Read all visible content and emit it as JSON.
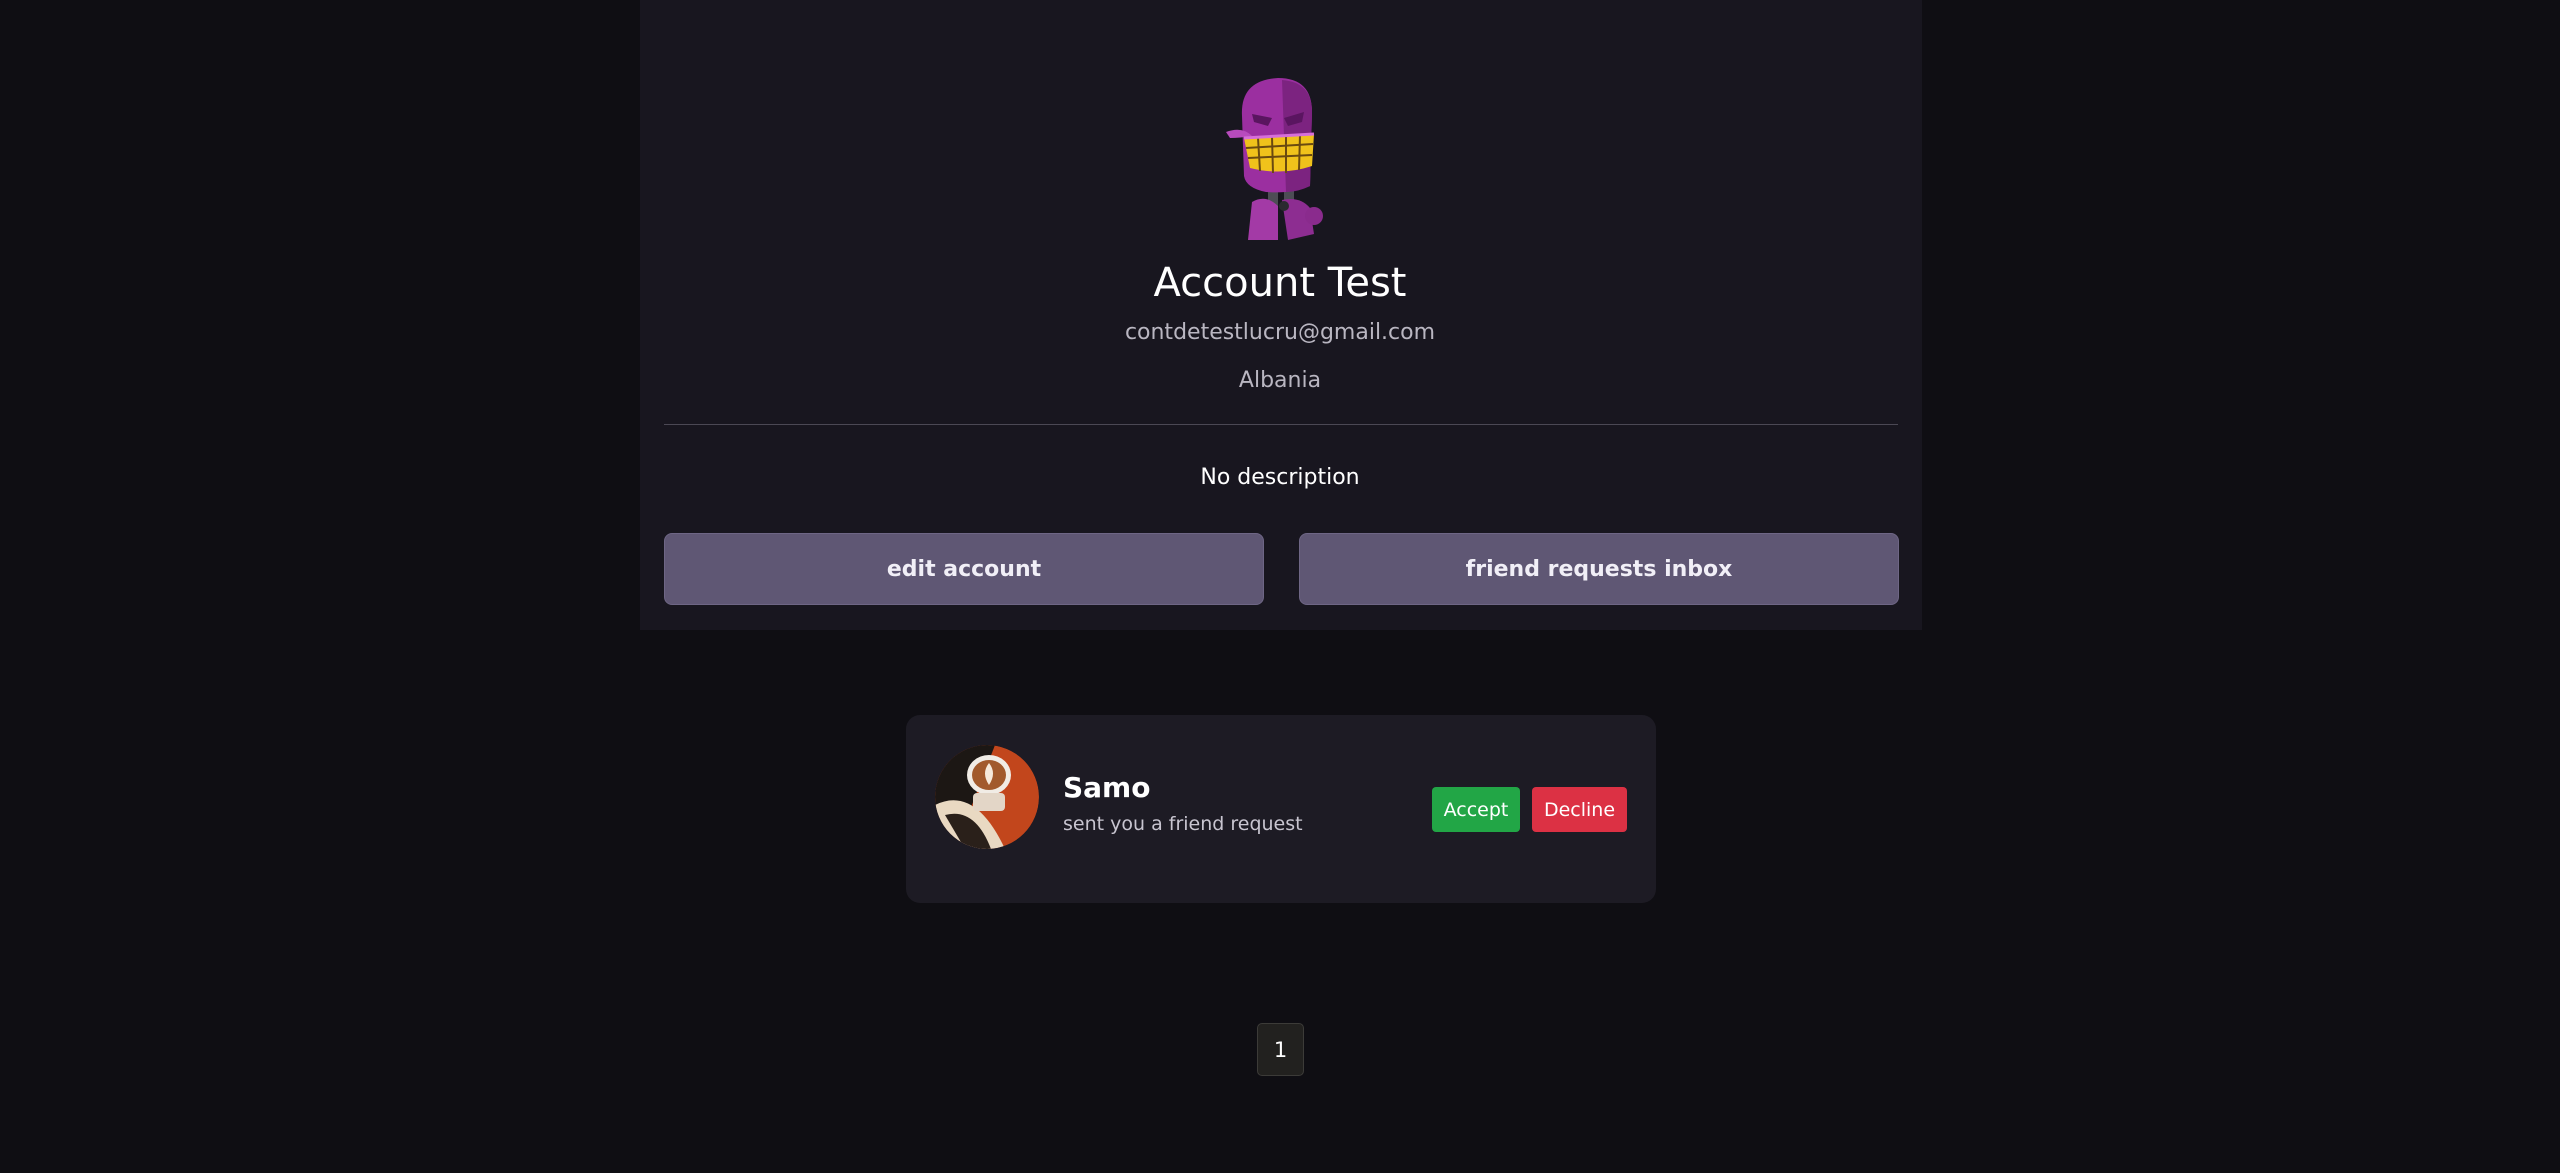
{
  "profile": {
    "name": "Account Test",
    "email": "contdetestlucru@gmail.com",
    "country": "Albania",
    "description": "No description",
    "edit_button": "edit account",
    "inbox_button": "friend requests inbox",
    "avatar_icon": "purple-robot-avatar"
  },
  "friend_requests": [
    {
      "name": "Samo",
      "message": "sent you a friend request",
      "accept_label": "Accept",
      "decline_label": "Decline",
      "avatar_icon": "latte-coffee-avatar"
    }
  ],
  "pagination": {
    "current_page": "1"
  },
  "colors": {
    "background": "#0f0e13",
    "card": "#18161f",
    "button": "#5f5774",
    "accept": "#22a646",
    "decline": "#dc3144"
  }
}
